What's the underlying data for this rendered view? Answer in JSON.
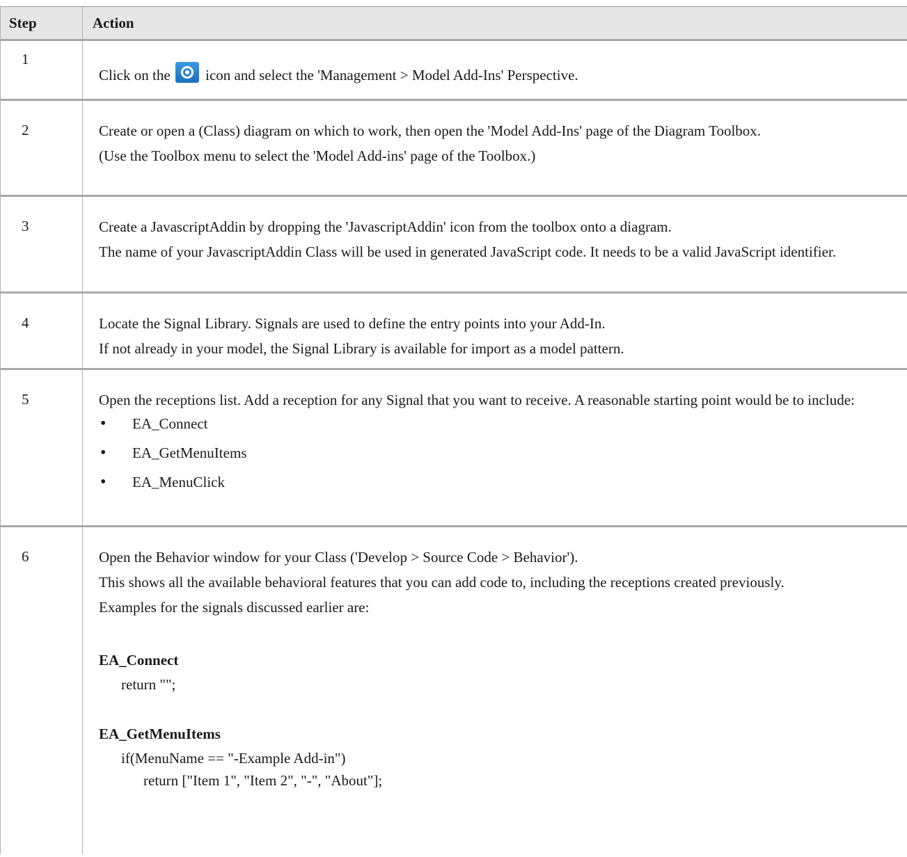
{
  "header": {
    "step": "Step",
    "action": "Action"
  },
  "rows": [
    {
      "step": "1",
      "pre_icon": "Click on the",
      "icon": "eye-icon",
      "post_icon": "icon and select the 'Management > Model Add-Ins' Perspective."
    },
    {
      "step": "2",
      "p1": "Create or open a (Class) diagram on which to work, then open the 'Model Add-Ins' page of the Diagram Toolbox.",
      "p2": "(Use the Toolbox menu to select the 'Model Add-ins' page of the Toolbox.)"
    },
    {
      "step": "3",
      "p1": "Create a JavascriptAddin by dropping the 'JavascriptAddin' icon from the toolbox onto a diagram.",
      "p2": "The name of your JavascriptAddin Class will be used in generated JavaScript code.  It needs to be a valid JavaScript identifier."
    },
    {
      "step": "4",
      "p1": "Locate the Signal Library.  Signals are used to define the entry points into your Add-In.",
      "p2": "If not already in your model, the Signal Library is available for import as a model pattern."
    },
    {
      "step": "5",
      "p1": "Open the receptions list.  Add a reception for any Signal that you want to receive.  A reasonable starting point would be to include:",
      "bullets": [
        "EA_Connect",
        "EA_GetMenuItems",
        "EA_MenuClick"
      ]
    },
    {
      "step": "6",
      "p1": "Open the Behavior window for your Class ('Develop > Source Code > Behavior').",
      "p2": "This shows all the available behavioral features that you can add code to, including the receptions created previously.",
      "p3": "Examples for the signals discussed earlier are:",
      "ex1_title": "EA_Connect",
      "ex1_line1": "return \"\";",
      "ex2_title": "EA_GetMenuItems",
      "ex2_line1": "if(MenuName == \"-Example Add-in\")",
      "ex2_line2": "return [\"Item 1\", \"Item 2\", \"-\", \"About\"];"
    }
  ]
}
